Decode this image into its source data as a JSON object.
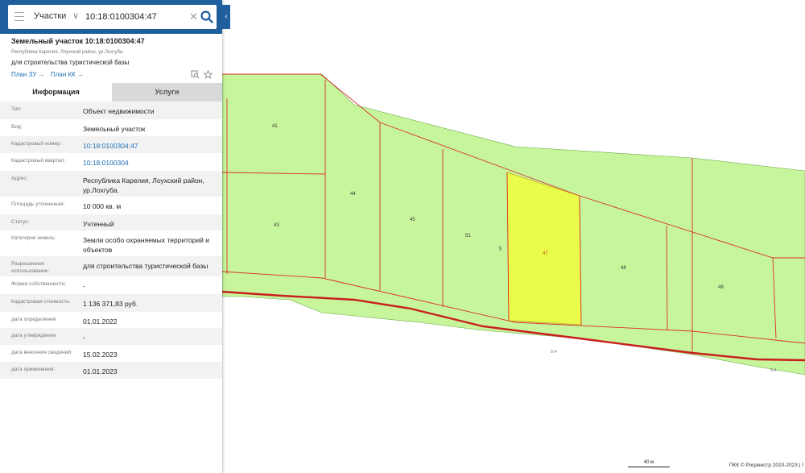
{
  "search": {
    "type_label": "Участки",
    "query": "10:18:0100304:47",
    "clear_icon": "close-icon",
    "search_icon": "search-icon",
    "menu_icon": "menu-icon"
  },
  "object": {
    "title": "Земельный участок 10:18:0100304:47",
    "address": "Республика Карелия, Лоухский район, ур.Лохгуба.",
    "purpose": "для строительства туристической базы",
    "plan_zu": "План ЗУ →",
    "plan_kk": "План КК →"
  },
  "tabs": {
    "info": "Информация",
    "services": "Услуги"
  },
  "props": [
    {
      "k": "Тип:",
      "v": "Объект недвижимости",
      "link": false,
      "h": 22
    },
    {
      "k": "Вид:",
      "v": "Земельный участок",
      "link": false,
      "h": 21
    },
    {
      "k": "Кадастровый номер:",
      "v": "10:18:0100304:47",
      "link": true,
      "h": 21
    },
    {
      "k": "Кадастровый квартал:",
      "v": "10:18:0100304",
      "link": true,
      "h": 22
    },
    {
      "k": "Адрес:",
      "v": "Республика Карелия, Лоухский район, ур.Лохгуба.",
      "link": false,
      "h": 32
    },
    {
      "k": "Площадь уточненная:",
      "v": "10 000 кв. м",
      "link": false,
      "h": 22
    },
    {
      "k": "Статус:",
      "v": "Учтенный",
      "link": false,
      "h": 20
    },
    {
      "k": "Категория земель:",
      "v": "Земли особо охраняемых территорий и объектов",
      "link": false,
      "h": 32
    },
    {
      "k": "Разрешенное использование:",
      "v": "для строительства туристической базы",
      "link": false,
      "h": 25
    },
    {
      "k": "Форма собственности:",
      "v": "-",
      "link": false,
      "h": 22
    },
    {
      "k": "Кадастровая стоимость:",
      "v": "1 136 371,83 руб.",
      "link": false,
      "h": 22
    },
    {
      "k": "дата определения:",
      "v": "01.01.2022",
      "link": false,
      "h": 20
    },
    {
      "k": "дата утверждения:",
      "v": "-",
      "link": false,
      "h": 21
    },
    {
      "k": "дата внесения сведений:",
      "v": "15.02.2023",
      "link": false,
      "h": 21
    },
    {
      "k": "дата применения:",
      "v": "01.01.2023",
      "link": false,
      "h": 21
    }
  ],
  "map": {
    "parcel_labels": [
      "41",
      "43",
      "44",
      "45",
      "51",
      "47",
      "48",
      "49",
      "ЗП"
    ],
    "road_labels": [
      "5:4",
      "5:4"
    ],
    "scale": "40 м",
    "attribution": "ПКК © Росреестр 2010-2023 | I",
    "colors": {
      "parcel_fill": "#c7f59c",
      "selected_fill": "#e9fc49",
      "boundary": "#d9302f",
      "accent": "#1f5f9e"
    }
  }
}
